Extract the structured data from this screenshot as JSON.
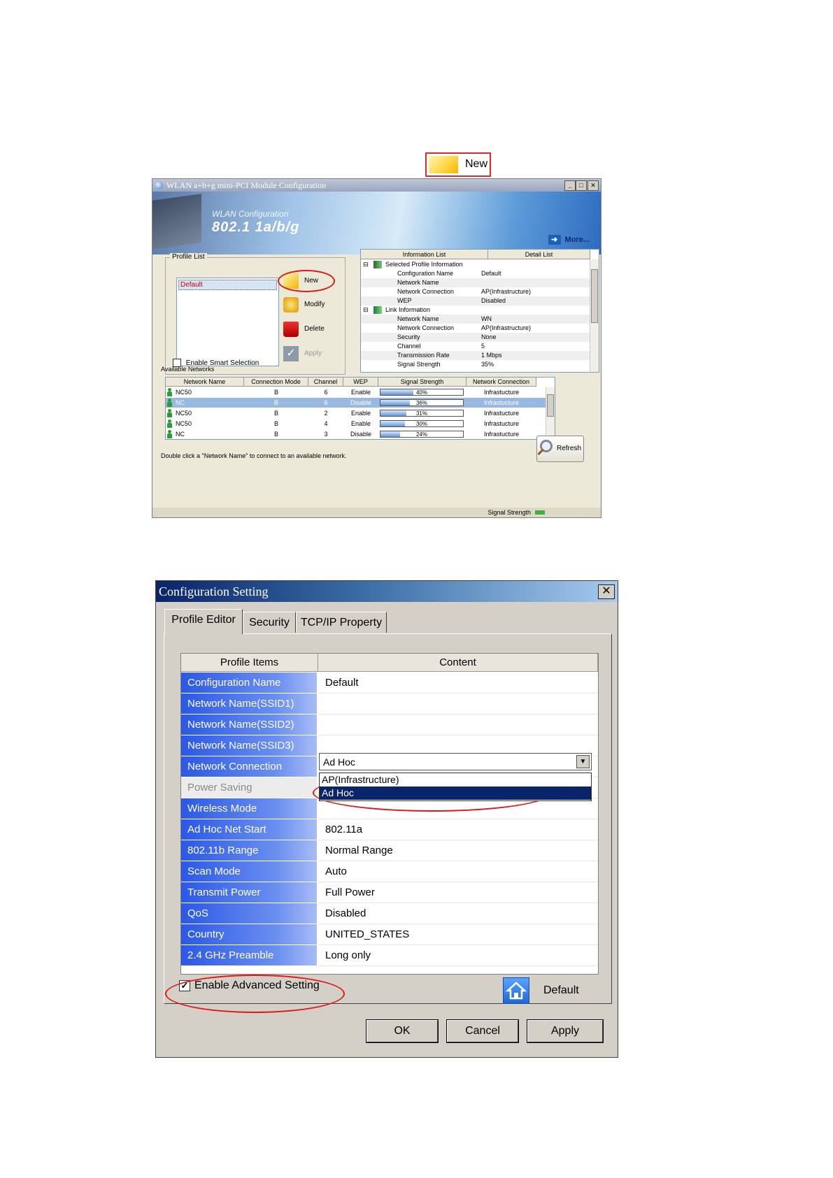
{
  "callout": {
    "label": "New"
  },
  "wlan_window": {
    "title": "WLAN a+b+g mini-PCI Module Configuration",
    "window_controls": {
      "minimize": "_",
      "maximize": "□",
      "close": "✕"
    },
    "banner": {
      "subtitle": "WLAN Configuration",
      "product": "802.1 1a/b/g",
      "more_label": "More..."
    },
    "profile_list": {
      "group_label": "Profile List",
      "items": [
        "Default"
      ],
      "buttons": {
        "new": "New",
        "modify": "Modify",
        "delete": "Delete",
        "apply": "Apply"
      },
      "smart_selection_label": "Enable Smart Selection"
    },
    "info_panel": {
      "headers": [
        "Information List",
        "Detail List"
      ],
      "selected_profile": {
        "title": "Selected Profile Information",
        "rows": [
          {
            "k": "Configuration Name",
            "v": "Default"
          },
          {
            "k": "Network Name",
            "v": ""
          },
          {
            "k": "Network Connection",
            "v": "AP(Infrastructure)"
          },
          {
            "k": "WEP",
            "v": "Disabled"
          }
        ]
      },
      "link_info": {
        "title": "Link Information",
        "rows": [
          {
            "k": "Network Name",
            "v": "WN"
          },
          {
            "k": "Network Connection",
            "v": "AP(Infrastructure)"
          },
          {
            "k": "Security",
            "v": "None"
          },
          {
            "k": "Channel",
            "v": "5"
          },
          {
            "k": "Transmission Rate",
            "v": "1 Mbps"
          },
          {
            "k": "Signal Strength",
            "v": "35%"
          }
        ]
      }
    },
    "available_networks": {
      "label": "Available Networks",
      "columns": [
        "Network Name",
        "Connection Mode",
        "Channel",
        "WEP",
        "Signal Strength",
        "Network Connection"
      ],
      "rows": [
        {
          "name": "NC50",
          "mode": "B",
          "channel": "6",
          "wep": "Enable",
          "signal": "40%",
          "signal_value": 0.4,
          "conn": "Infrastucture"
        },
        {
          "name": "NC",
          "mode": "B",
          "channel": "6",
          "wep": "Disable",
          "signal": "36%",
          "signal_value": 0.36,
          "conn": "Infrastucture"
        },
        {
          "name": "NC50",
          "mode": "B",
          "channel": "2",
          "wep": "Enable",
          "signal": "31%",
          "signal_value": 0.31,
          "conn": "Infrastucture"
        },
        {
          "name": "NC50",
          "mode": "B",
          "channel": "4",
          "wep": "Enable",
          "signal": "30%",
          "signal_value": 0.3,
          "conn": "Infrastucture"
        },
        {
          "name": "NC",
          "mode": "B",
          "channel": "3",
          "wep": "Disable",
          "signal": "24%",
          "signal_value": 0.24,
          "conn": "Infrastucture"
        }
      ],
      "hint": "Double click a \"Network Name\" to connect to an available network.",
      "refresh_label": "Refresh"
    },
    "status_bar": {
      "text": "Signal Strength"
    }
  },
  "config_window": {
    "title": "Configuration Setting",
    "close_glyph": "✕",
    "tabs": [
      "Profile Editor",
      "Security",
      "TCP/IP Property"
    ],
    "columns": [
      "Profile Items",
      "Content"
    ],
    "rows": [
      {
        "k": "Configuration Name",
        "v": "Default"
      },
      {
        "k": "Network Name(SSID1)",
        "v": ""
      },
      {
        "k": "Network Name(SSID2)",
        "v": ""
      },
      {
        "k": "Network Name(SSID3)",
        "v": ""
      },
      {
        "k": "Network Connection",
        "v": "Ad Hoc"
      },
      {
        "k": "Power Saving",
        "v": ""
      },
      {
        "k": "Wireless Mode",
        "v": ""
      },
      {
        "k": "Ad Hoc Net Start",
        "v": "802.11a"
      },
      {
        "k": "802.11b Range",
        "v": "Normal Range"
      },
      {
        "k": "Scan Mode",
        "v": "Auto"
      },
      {
        "k": "Transmit Power",
        "v": "Full Power"
      },
      {
        "k": "QoS",
        "v": "Disabled"
      },
      {
        "k": "Country",
        "v": "UNITED_STATES"
      },
      {
        "k": "2.4 GHz Preamble",
        "v": "Long only"
      }
    ],
    "network_connection_dropdown": {
      "selected": "Ad Hoc",
      "options": [
        "AP(Infrastructure)",
        "Ad Hoc"
      ],
      "highlighted": "Ad Hoc"
    },
    "advanced_setting_label": "Enable Advanced Setting",
    "default_label": "Default",
    "buttons": {
      "ok": "OK",
      "cancel": "Cancel",
      "apply": "Apply"
    }
  }
}
